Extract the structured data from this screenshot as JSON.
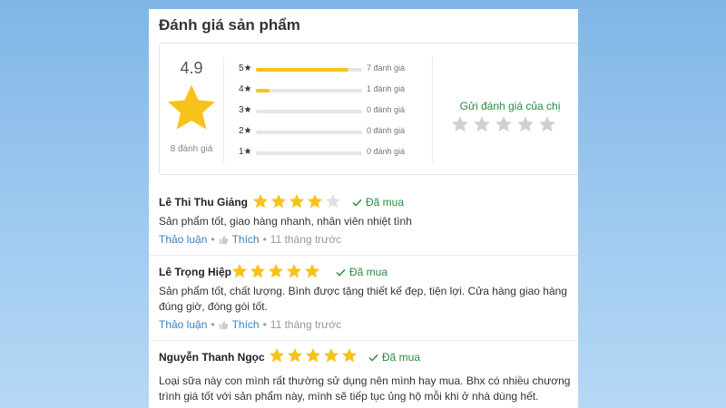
{
  "title": "Đánh giá sản phẩm",
  "summary": {
    "average": "4.9",
    "total_label": "8 đánh giá",
    "bars": [
      {
        "label": "5★",
        "fraction": 0.875,
        "count_label": "7 đánh giá"
      },
      {
        "label": "4★",
        "fraction": 0.125,
        "count_label": "1 đánh giá"
      },
      {
        "label": "3★",
        "fraction": 0,
        "count_label": "0 đánh giá"
      },
      {
        "label": "2★",
        "fraction": 0,
        "count_label": "0 đánh giá"
      },
      {
        "label": "1★",
        "fraction": 0,
        "count_label": "0 đánh giá"
      }
    ],
    "rate_prompt": "Gửi đánh giá của chị"
  },
  "colors": {
    "star": "#f7c21b",
    "star_empty": "#e0e0e0",
    "rate_star": "#cfcfcf",
    "green": "#2a8a3e",
    "link": "#3a7fbf"
  },
  "reviews": [
    {
      "name": "Lê Thi Thu Giảng",
      "stars": 4,
      "bought": "Đã mua",
      "text": "Sản phẩm tốt, giao hàng nhanh, nhân viên nhiệt tình",
      "discuss": "Thảo luận",
      "like": "Thích",
      "time": "11 tháng trước"
    },
    {
      "name": "Lê Trọng Hiệp",
      "stars": 5,
      "bought": "Đã mua",
      "text": "Sản phẩm tốt, chất lượng. Bình được tặng thiết kế đẹp, tiện lợi. Cửa hàng giao hàng đúng giờ, đóng gói tốt.",
      "discuss": "Thảo luận",
      "like": "Thích",
      "time": "11 tháng trước"
    },
    {
      "name": "Nguyễn Thanh Ngọc",
      "stars": 5,
      "bought": "Đã mua",
      "text": "Loại sữa này con mình rất thường sử dụng nên mình hay mua. Bhx có nhiều chương trình giá tốt với sản phẩm này, mình sẽ tiếp tục ủng hộ mỗi khi ở nhà dùng hết.",
      "discuss": "",
      "like": "",
      "time": ""
    }
  ]
}
